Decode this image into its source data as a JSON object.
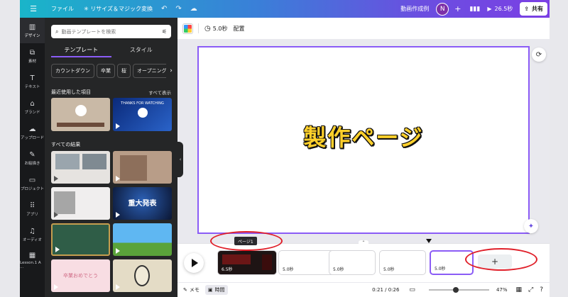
{
  "topbar": {
    "menu_file": "ファイル",
    "menu_resize": "リサイズ＆マジック変換",
    "project_name": "動画作成例",
    "avatar_initial": "N",
    "duration": "26.5秒",
    "share_label": "共有"
  },
  "rail": [
    {
      "label": "デザイン",
      "icon": "▥"
    },
    {
      "label": "素材",
      "icon": "⧉"
    },
    {
      "label": "テキスト",
      "icon": "T"
    },
    {
      "label": "ブランド",
      "icon": "⌂"
    },
    {
      "label": "アップロード",
      "icon": "☁"
    },
    {
      "label": "お絵描き",
      "icon": "✎"
    },
    {
      "label": "プロジェクト",
      "icon": "▭"
    },
    {
      "label": "アプリ",
      "icon": "⠿"
    },
    {
      "label": "オーディオ",
      "icon": "♫"
    },
    {
      "label": "Lesson.1 A ...",
      "icon": "▦"
    }
  ],
  "panel": {
    "search_placeholder": "動画テンプレートを検索",
    "tab_template": "テンプレート",
    "tab_style": "スタイル",
    "chips": [
      "カウントダウン",
      "卒業",
      "桜",
      "オープニング"
    ],
    "recent_title": "最近使用した項目",
    "see_all": "すべて表示",
    "all_results_title": "すべての結果",
    "thumb_thanks": "THANKS FOR WATCHING",
    "thumb_juudai": "重大発表",
    "thumb_sotsugyou": "卒業おめでとう"
  },
  "toolbar": {
    "duration": "5.0秒",
    "arrange": "配置"
  },
  "canvas": {
    "title": "製作ページ"
  },
  "timeline": {
    "page_badge": "ページ1",
    "clips": [
      {
        "duration": "6.5秒"
      },
      {
        "duration": "5.0秒"
      },
      {
        "duration": "5.0秒"
      },
      {
        "duration": "5.0秒"
      },
      {
        "duration": "5.0秒"
      }
    ],
    "add_label": "+"
  },
  "bottombar": {
    "memo": "メモ",
    "time_label": "時間",
    "timecode": "0:21 / 0:26",
    "zoom": "47%",
    "help": "?"
  }
}
